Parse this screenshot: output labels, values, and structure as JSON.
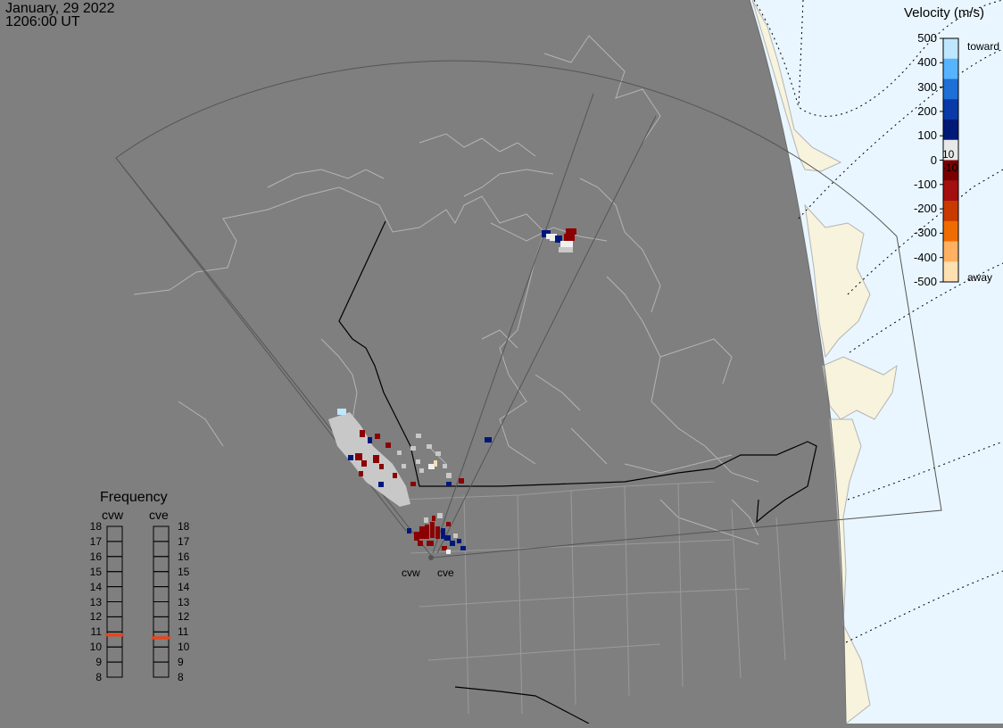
{
  "header": {
    "date": "January, 29 2022",
    "time": "1206:00 UT"
  },
  "velocity_legend": {
    "title": "Velocity (m/s)",
    "ticks": [
      "500",
      "400",
      "300",
      "200",
      "100",
      "0",
      "-100",
      "-200",
      "-300",
      "-400",
      "-500"
    ],
    "threshold_pos": "10",
    "threshold_neg": "-10",
    "toward_label": "toward",
    "away_label": "away",
    "colors": [
      "#bfe6ff",
      "#56b4ff",
      "#1e6fd6",
      "#0a3aa8",
      "#001a78",
      "#e8e8e8",
      "#7a0000",
      "#a40f0f",
      "#c83a00",
      "#ef6c00",
      "#ffb060",
      "#ffe0b0"
    ]
  },
  "frequency_panel": {
    "title": "Frequency",
    "radars": [
      {
        "name": "cvw",
        "frequency_mhz": 10.8
      },
      {
        "name": "cve",
        "frequency_mhz": 10.6
      }
    ],
    "scale": [
      "18",
      "17",
      "16",
      "15",
      "14",
      "13",
      "12",
      "11",
      "10",
      "9",
      "8"
    ],
    "marker_color": "#e8451b"
  },
  "map": {
    "sites": [
      {
        "label": "cvw"
      },
      {
        "label": "cve"
      }
    ],
    "colors": {
      "land": "#7f7f7f",
      "night_edge_ocean": "#e9f6ff",
      "day_land": "#f7f3dc",
      "coast": "#b4b4b4",
      "boundary": "#000000",
      "fov": "#5a5a5a",
      "terminator": "#000000",
      "ground_scatter": "#c8c8c8"
    }
  }
}
